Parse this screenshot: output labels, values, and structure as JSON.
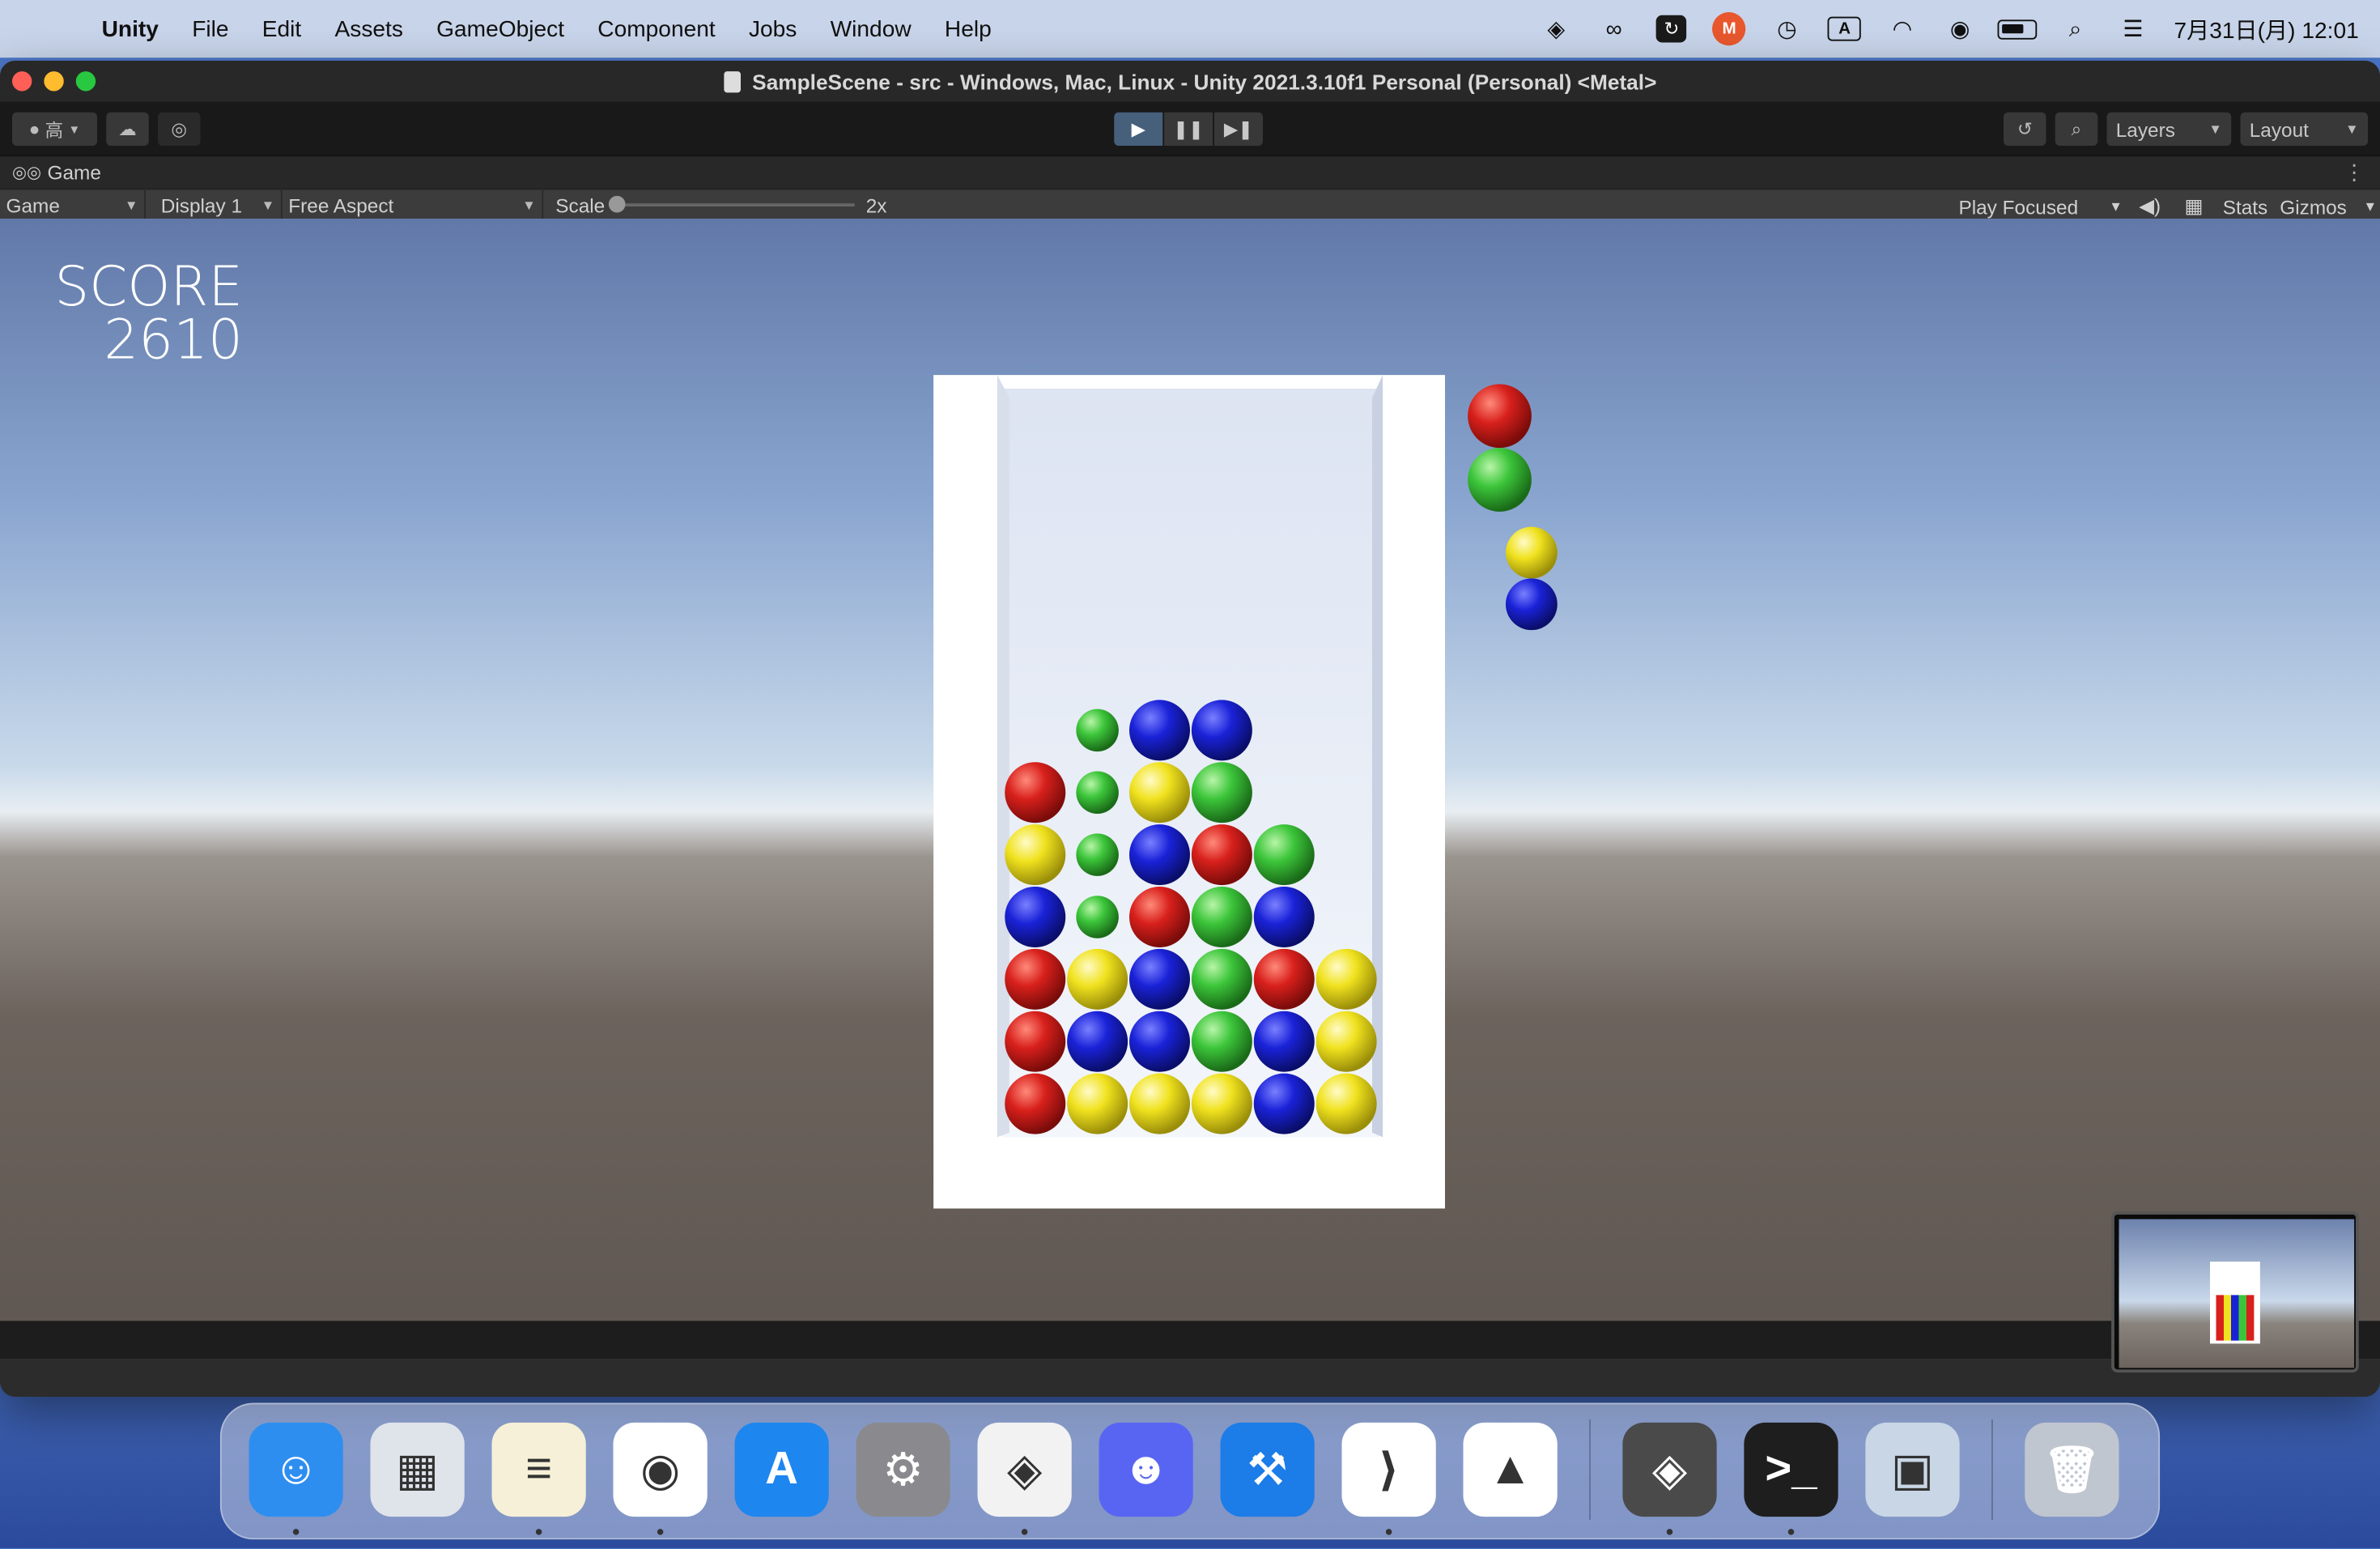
{
  "menubar": {
    "app_name": "Unity",
    "items": [
      "File",
      "Edit",
      "Assets",
      "GameObject",
      "Component",
      "Jobs",
      "Window",
      "Help"
    ],
    "tray": [
      "unity-hub-icon",
      "creative-cloud-icon",
      "screen-capture-icon",
      "fuse-icon",
      "time-machine-icon",
      "input-source-icon",
      "wifi-icon",
      "user-icon",
      "battery-icon",
      "spotlight-icon",
      "control-center-icon"
    ],
    "input_source_label": "A",
    "clock": "7月31日(月)  12:01"
  },
  "window": {
    "title": "SampleScene - src - Windows, Mac, Linux - Unity 2021.3.10f1 Personal (Personal) <Metal>"
  },
  "toolbar": {
    "account_label": "高",
    "layers_label": "Layers",
    "layout_label": "Layout"
  },
  "game_tab": {
    "label": "Game"
  },
  "game_bar": {
    "view_label": "Game",
    "display_label": "Display 1",
    "aspect_label": "Free Aspect",
    "scale_label": "Scale",
    "scale_value": "2x",
    "play_mode_label": "Play Focused",
    "stats_label": "Stats",
    "gizmos_label": "Gizmos"
  },
  "game": {
    "score_label": "SCORE",
    "score_value": "2610",
    "colors": {
      "R": "#d8201c",
      "G": "#3cc53a",
      "B": "#1a22d8",
      "Y": "#f0e21e"
    },
    "grid": [
      [
        "",
        "g",
        "B",
        "B",
        "",
        ""
      ],
      [
        "R",
        "g",
        "Y",
        "G",
        "",
        ""
      ],
      [
        "Y",
        "g",
        "B",
        "R",
        "G",
        ""
      ],
      [
        "B",
        "g",
        "R",
        "G",
        "B",
        ""
      ],
      [
        "R",
        "Y",
        "B",
        "G",
        "R",
        "Y"
      ],
      [
        "R",
        "B",
        "B",
        "G",
        "B",
        "Y"
      ],
      [
        "R",
        "Y",
        "Y",
        "Y",
        "B",
        "Y"
      ]
    ],
    "next_pieces": [
      [
        "R",
        "G"
      ],
      [
        "Y",
        "B"
      ]
    ]
  },
  "dock": {
    "apps": [
      {
        "name": "finder",
        "color": "#2e8ef0",
        "glyph": "☺",
        "running": true
      },
      {
        "name": "launchpad",
        "color": "#dfe3ea",
        "glyph": "▦",
        "running": false
      },
      {
        "name": "notes",
        "color": "#f6f0d8",
        "glyph": "≡",
        "running": true
      },
      {
        "name": "chrome",
        "color": "#ffffff",
        "glyph": "◉",
        "running": true
      },
      {
        "name": "app-store",
        "color": "#1e86ef",
        "glyph": "A",
        "running": false
      },
      {
        "name": "system-settings",
        "color": "#8a8a8e",
        "glyph": "⚙",
        "running": false
      },
      {
        "name": "unity-hub",
        "color": "#f2f2f2",
        "glyph": "◈",
        "running": true
      },
      {
        "name": "discord",
        "color": "#5865f2",
        "glyph": "☻",
        "running": false
      },
      {
        "name": "xcode",
        "color": "#1c7ce8",
        "glyph": "⚒",
        "running": false
      },
      {
        "name": "vscode",
        "color": "#ffffff",
        "glyph": "⟩",
        "running": true
      },
      {
        "name": "android-studio",
        "color": "#ffffff",
        "glyph": "▲",
        "running": false
      }
    ],
    "apps_right": [
      {
        "name": "unity",
        "color": "#4a4a4a",
        "glyph": "◈",
        "running": true
      },
      {
        "name": "terminal",
        "color": "#1e1e1e",
        "glyph": ">_",
        "running": true
      },
      {
        "name": "preview",
        "color": "#c9d6e6",
        "glyph": "▣",
        "running": false
      }
    ]
  }
}
